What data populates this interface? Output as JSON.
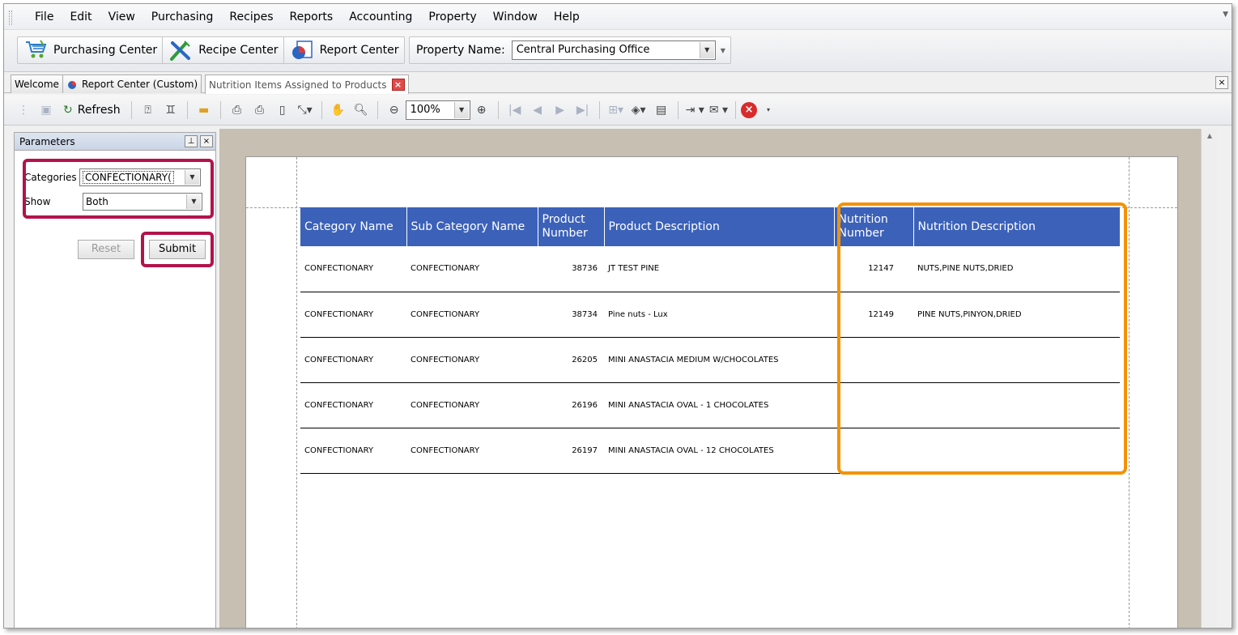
{
  "menu": [
    "File",
    "Edit",
    "View",
    "Purchasing",
    "Recipes",
    "Reports",
    "Accounting",
    "Property",
    "Window",
    "Help"
  ],
  "toolbar": {
    "purchasing_center": "Purchasing Center",
    "recipe_center": "Recipe Center",
    "report_center": "Report Center",
    "property_label": "Property Name:",
    "property_value": "Central Purchasing Office"
  },
  "tabs": {
    "welcome": "Welcome",
    "report_center": "Report Center (Custom)",
    "active": "Nutrition Items Assigned to Products"
  },
  "report_toolbar": {
    "refresh": "Refresh",
    "zoom": "100%"
  },
  "params": {
    "title": "Parameters",
    "categories_label": "Categories",
    "categories_value": "CONFECTIONARY(",
    "show_label": "Show",
    "show_value": "Both",
    "reset": "Reset",
    "submit": "Submit"
  },
  "report": {
    "headers": [
      "Category Name",
      "Sub Category Name",
      "Product Number",
      "Product Description",
      "Nutrition Number",
      "Nutrition Description"
    ],
    "rows": [
      {
        "category": "CONFECTIONARY",
        "subcategory": "CONFECTIONARY",
        "product_number": "38736",
        "product_description": "JT TEST PINE",
        "nutrition_number": "12147",
        "nutrition_description": "NUTS,PINE NUTS,DRIED"
      },
      {
        "category": "CONFECTIONARY",
        "subcategory": "CONFECTIONARY",
        "product_number": "38734",
        "product_description": "Pine nuts - Lux",
        "nutrition_number": "12149",
        "nutrition_description": "PINE NUTS,PINYON,DRIED"
      },
      {
        "category": "CONFECTIONARY",
        "subcategory": "CONFECTIONARY",
        "product_number": "26205",
        "product_description": "MINI ANASTACIA MEDIUM W/CHOCOLATES",
        "nutrition_number": "",
        "nutrition_description": ""
      },
      {
        "category": "CONFECTIONARY",
        "subcategory": "CONFECTIONARY",
        "product_number": "26196",
        "product_description": "MINI ANASTACIA OVAL - 1 CHOCOLATES",
        "nutrition_number": "",
        "nutrition_description": ""
      },
      {
        "category": "CONFECTIONARY",
        "subcategory": "CONFECTIONARY",
        "product_number": "26197",
        "product_description": "MINI ANASTACIA OVAL - 12 CHOCOLATES",
        "nutrition_number": "",
        "nutrition_description": ""
      }
    ]
  },
  "colors": {
    "header_blue": "#3b61b9",
    "highlight_red": "#b4124a",
    "highlight_orange": "#f39200"
  }
}
